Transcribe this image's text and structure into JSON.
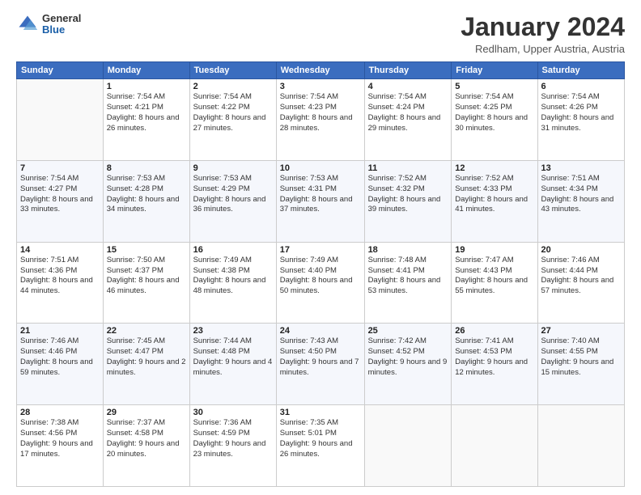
{
  "header": {
    "logo_general": "General",
    "logo_blue": "Blue",
    "month_title": "January 2024",
    "location": "Redlham, Upper Austria, Austria"
  },
  "days_of_week": [
    "Sunday",
    "Monday",
    "Tuesday",
    "Wednesday",
    "Thursday",
    "Friday",
    "Saturday"
  ],
  "weeks": [
    [
      {
        "day": "",
        "sunrise": "",
        "sunset": "",
        "daylight": ""
      },
      {
        "day": "1",
        "sunrise": "Sunrise: 7:54 AM",
        "sunset": "Sunset: 4:21 PM",
        "daylight": "Daylight: 8 hours and 26 minutes."
      },
      {
        "day": "2",
        "sunrise": "Sunrise: 7:54 AM",
        "sunset": "Sunset: 4:22 PM",
        "daylight": "Daylight: 8 hours and 27 minutes."
      },
      {
        "day": "3",
        "sunrise": "Sunrise: 7:54 AM",
        "sunset": "Sunset: 4:23 PM",
        "daylight": "Daylight: 8 hours and 28 minutes."
      },
      {
        "day": "4",
        "sunrise": "Sunrise: 7:54 AM",
        "sunset": "Sunset: 4:24 PM",
        "daylight": "Daylight: 8 hours and 29 minutes."
      },
      {
        "day": "5",
        "sunrise": "Sunrise: 7:54 AM",
        "sunset": "Sunset: 4:25 PM",
        "daylight": "Daylight: 8 hours and 30 minutes."
      },
      {
        "day": "6",
        "sunrise": "Sunrise: 7:54 AM",
        "sunset": "Sunset: 4:26 PM",
        "daylight": "Daylight: 8 hours and 31 minutes."
      }
    ],
    [
      {
        "day": "7",
        "sunrise": "Sunrise: 7:54 AM",
        "sunset": "Sunset: 4:27 PM",
        "daylight": "Daylight: 8 hours and 33 minutes."
      },
      {
        "day": "8",
        "sunrise": "Sunrise: 7:53 AM",
        "sunset": "Sunset: 4:28 PM",
        "daylight": "Daylight: 8 hours and 34 minutes."
      },
      {
        "day": "9",
        "sunrise": "Sunrise: 7:53 AM",
        "sunset": "Sunset: 4:29 PM",
        "daylight": "Daylight: 8 hours and 36 minutes."
      },
      {
        "day": "10",
        "sunrise": "Sunrise: 7:53 AM",
        "sunset": "Sunset: 4:31 PM",
        "daylight": "Daylight: 8 hours and 37 minutes."
      },
      {
        "day": "11",
        "sunrise": "Sunrise: 7:52 AM",
        "sunset": "Sunset: 4:32 PM",
        "daylight": "Daylight: 8 hours and 39 minutes."
      },
      {
        "day": "12",
        "sunrise": "Sunrise: 7:52 AM",
        "sunset": "Sunset: 4:33 PM",
        "daylight": "Daylight: 8 hours and 41 minutes."
      },
      {
        "day": "13",
        "sunrise": "Sunrise: 7:51 AM",
        "sunset": "Sunset: 4:34 PM",
        "daylight": "Daylight: 8 hours and 43 minutes."
      }
    ],
    [
      {
        "day": "14",
        "sunrise": "Sunrise: 7:51 AM",
        "sunset": "Sunset: 4:36 PM",
        "daylight": "Daylight: 8 hours and 44 minutes."
      },
      {
        "day": "15",
        "sunrise": "Sunrise: 7:50 AM",
        "sunset": "Sunset: 4:37 PM",
        "daylight": "Daylight: 8 hours and 46 minutes."
      },
      {
        "day": "16",
        "sunrise": "Sunrise: 7:49 AM",
        "sunset": "Sunset: 4:38 PM",
        "daylight": "Daylight: 8 hours and 48 minutes."
      },
      {
        "day": "17",
        "sunrise": "Sunrise: 7:49 AM",
        "sunset": "Sunset: 4:40 PM",
        "daylight": "Daylight: 8 hours and 50 minutes."
      },
      {
        "day": "18",
        "sunrise": "Sunrise: 7:48 AM",
        "sunset": "Sunset: 4:41 PM",
        "daylight": "Daylight: 8 hours and 53 minutes."
      },
      {
        "day": "19",
        "sunrise": "Sunrise: 7:47 AM",
        "sunset": "Sunset: 4:43 PM",
        "daylight": "Daylight: 8 hours and 55 minutes."
      },
      {
        "day": "20",
        "sunrise": "Sunrise: 7:46 AM",
        "sunset": "Sunset: 4:44 PM",
        "daylight": "Daylight: 8 hours and 57 minutes."
      }
    ],
    [
      {
        "day": "21",
        "sunrise": "Sunrise: 7:46 AM",
        "sunset": "Sunset: 4:46 PM",
        "daylight": "Daylight: 8 hours and 59 minutes."
      },
      {
        "day": "22",
        "sunrise": "Sunrise: 7:45 AM",
        "sunset": "Sunset: 4:47 PM",
        "daylight": "Daylight: 9 hours and 2 minutes."
      },
      {
        "day": "23",
        "sunrise": "Sunrise: 7:44 AM",
        "sunset": "Sunset: 4:48 PM",
        "daylight": "Daylight: 9 hours and 4 minutes."
      },
      {
        "day": "24",
        "sunrise": "Sunrise: 7:43 AM",
        "sunset": "Sunset: 4:50 PM",
        "daylight": "Daylight: 9 hours and 7 minutes."
      },
      {
        "day": "25",
        "sunrise": "Sunrise: 7:42 AM",
        "sunset": "Sunset: 4:52 PM",
        "daylight": "Daylight: 9 hours and 9 minutes."
      },
      {
        "day": "26",
        "sunrise": "Sunrise: 7:41 AM",
        "sunset": "Sunset: 4:53 PM",
        "daylight": "Daylight: 9 hours and 12 minutes."
      },
      {
        "day": "27",
        "sunrise": "Sunrise: 7:40 AM",
        "sunset": "Sunset: 4:55 PM",
        "daylight": "Daylight: 9 hours and 15 minutes."
      }
    ],
    [
      {
        "day": "28",
        "sunrise": "Sunrise: 7:38 AM",
        "sunset": "Sunset: 4:56 PM",
        "daylight": "Daylight: 9 hours and 17 minutes."
      },
      {
        "day": "29",
        "sunrise": "Sunrise: 7:37 AM",
        "sunset": "Sunset: 4:58 PM",
        "daylight": "Daylight: 9 hours and 20 minutes."
      },
      {
        "day": "30",
        "sunrise": "Sunrise: 7:36 AM",
        "sunset": "Sunset: 4:59 PM",
        "daylight": "Daylight: 9 hours and 23 minutes."
      },
      {
        "day": "31",
        "sunrise": "Sunrise: 7:35 AM",
        "sunset": "Sunset: 5:01 PM",
        "daylight": "Daylight: 9 hours and 26 minutes."
      },
      {
        "day": "",
        "sunrise": "",
        "sunset": "",
        "daylight": ""
      },
      {
        "day": "",
        "sunrise": "",
        "sunset": "",
        "daylight": ""
      },
      {
        "day": "",
        "sunrise": "",
        "sunset": "",
        "daylight": ""
      }
    ]
  ]
}
